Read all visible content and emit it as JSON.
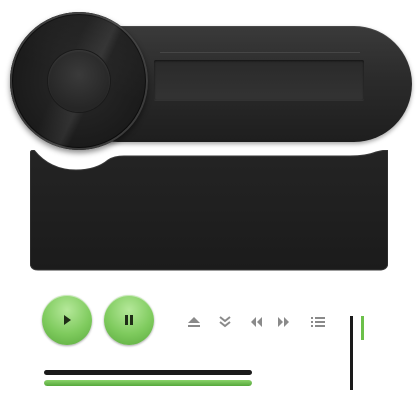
{
  "player": {
    "display_text": "",
    "colors": {
      "body": "#2b2b2b",
      "panel": "#1f1f1f",
      "accent_green": "#7fcb5e",
      "track_dark": "#1a1a1a"
    }
  },
  "controls": {
    "play": {
      "icon": "play-icon"
    },
    "pause": {
      "icon": "pause-icon"
    },
    "eject": {
      "icon": "eject-icon"
    },
    "scroll_down": {
      "icon": "chevron-double-down-icon"
    },
    "rewind": {
      "icon": "rewind-icon"
    },
    "forward": {
      "icon": "fast-forward-icon"
    },
    "playlist": {
      "icon": "list-icon"
    }
  },
  "progress": {
    "seek_fraction": 1.0,
    "volume_fraction": 1.0,
    "vertical_level_fraction": 0.32
  }
}
